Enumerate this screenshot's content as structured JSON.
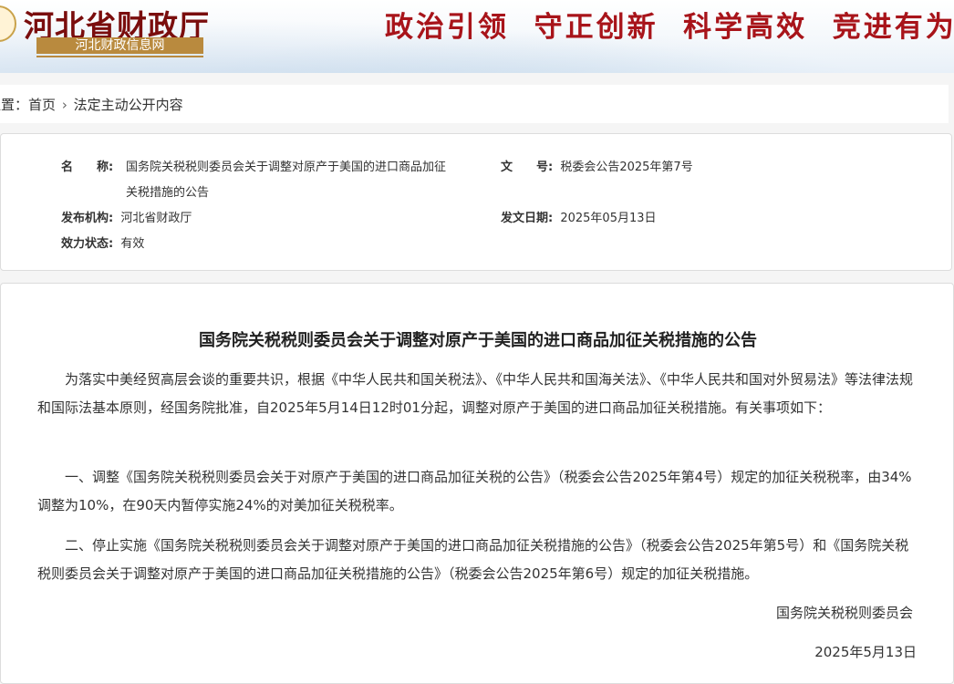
{
  "header": {
    "site_title": "河北省财政厅",
    "site_subtitle": "河北财政信息网",
    "slogan": "政治引领  守正创新  科学高效  竞进有为"
  },
  "breadcrumb": {
    "prefix": "位置：",
    "home": "首页",
    "separator": "›",
    "current": "法定主动公开内容"
  },
  "meta": {
    "name_label": "名　　称:",
    "name_value_line1": "国务院关税税则委员会关于调整对原产于美国的进口商品加征",
    "name_value_line2": "关税措施的公告",
    "doc_no_label": "文　　号:",
    "doc_no_value": "税委会公告2025年第7号",
    "issuer_label": "发布机构:",
    "issuer_value": "河北省财政厅",
    "date_label": "发文日期:",
    "date_value": "2025年05月13日",
    "status_label": "效力状态:",
    "status_value": "有效"
  },
  "article": {
    "title": "国务院关税税则委员会关于调整对原产于美国的进口商品加征关税措施的公告",
    "paragraphs": [
      "为落实中美经贸高层会谈的重要共识，根据《中华人民共和国关税法》、《中华人民共和国海关法》、《中华人民共和国对外贸易法》等法律法规和国际法基本原则，经国务院批准，自2025年5月14日12时01分起，调整对原产于美国的进口商品加征关税措施。有关事项如下：",
      "一、调整《国务院关税税则委员会关于对原产于美国的进口商品加征关税的公告》（税委会公告2025年第4号）规定的加征关税税率，由34%调整为10%，在90天内暂停实施24%的对美加征关税税率。",
      "二、停止实施《国务院关税税则委员会关于调整对原产于美国的进口商品加征关税措施的公告》（税委会公告2025年第5号）和《国务院关税税则委员会关于调整对原产于美国的进口商品加征关税措施的公告》（税委会公告2025年第6号）规定的加征关税措施。"
    ],
    "signature": "国务院关税税则委员会",
    "sign_date": "2025年5月13日"
  }
}
